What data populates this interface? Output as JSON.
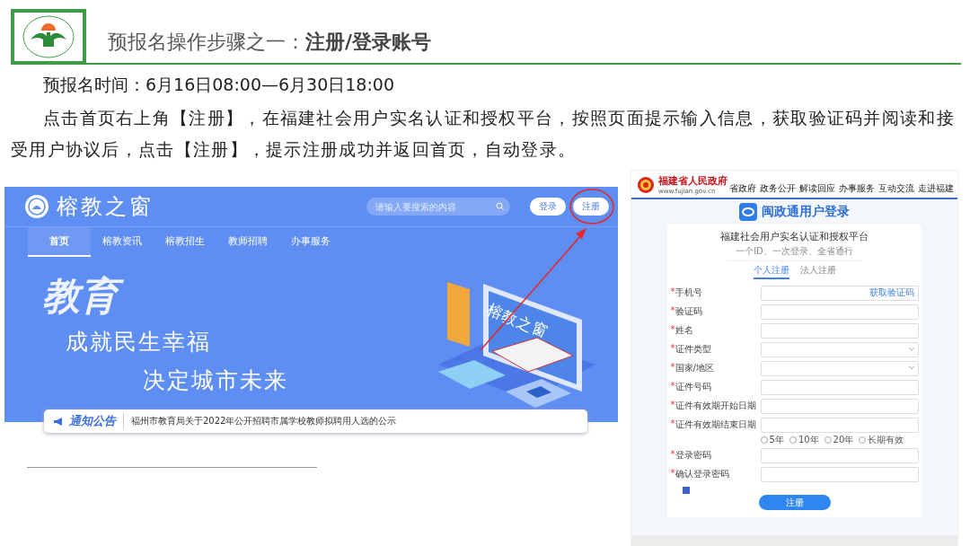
{
  "slide": {
    "title": "预报名操作步骤之一：**注册/登录账号**",
    "time_line": "预报名时间：6月16日08:00—6月30日18:00",
    "instructions": "点击首页右上角【注册】，在福建社会用户实名认证和授权平台，按照页面提示输入信息，获取验证码并阅读和接受用户协议后，点击【注册】，提示注册成功并返回首页，自动登录。"
  },
  "left_screenshot": {
    "site_name": "榕教之窗",
    "search": {
      "placeholder": "请输入要搜索的内容"
    },
    "buttons": [
      "登录",
      "注册"
    ],
    "nav": [
      {
        "label": "首页",
        "selected": true
      },
      {
        "label": "榕教资讯",
        "selected": false
      },
      {
        "label": "榕教招生",
        "selected": false
      },
      {
        "label": "教师招聘",
        "selected": false
      },
      {
        "label": "办事服务",
        "selected": false
      }
    ],
    "hero": {
      "headline": "教育",
      "line_1": "成就民生幸福",
      "line_2": "决定城市未来",
      "screen_label": "榕教之窗"
    },
    "notice": {
      "badge": "通知公告",
      "text": "福州市教育局关于2022年公开招聘市属学校教师拟聘用人选的公示"
    }
  },
  "right_screenshot": {
    "site_name": "福建省人民政府",
    "url": "www.fujian.gov.cn",
    "nav": [
      "省政府",
      "政务公开",
      "解读回应",
      "办事服务",
      "互动交流",
      "走进福建"
    ],
    "login_title": "闽政通用户登录",
    "card": {
      "title": "福建社会用户实名认证和授权平台",
      "subtitle": "一个ID、一次登录、全省通行",
      "tabs": [
        {
          "label": "个人注册",
          "selected": true
        },
        {
          "label": "法人注册",
          "selected": false
        }
      ],
      "fields": [
        {
          "label": "手机号",
          "required_mark": "*",
          "kind": "input",
          "action": "获取验证码"
        },
        {
          "label": "验证码",
          "required_mark": "*",
          "kind": "input"
        },
        {
          "label": "姓名",
          "required_mark": "*",
          "kind": "input"
        },
        {
          "label": "证件类型",
          "required_mark": "*",
          "kind": "select"
        },
        {
          "label": "国家/地区",
          "required_mark": "*",
          "kind": "select"
        },
        {
          "label": "证件号码",
          "required_mark": "*",
          "kind": "input"
        },
        {
          "label": "证件有效期开始日期",
          "required_mark": "*",
          "kind": "input"
        },
        {
          "label": "证件有效期结束日期",
          "required_mark": "*",
          "kind": "input"
        }
      ],
      "validity_options": [
        {
          "label": "5年",
          "selected": false
        },
        {
          "label": "10年",
          "selected": false
        },
        {
          "label": "20年",
          "selected": false
        },
        {
          "label": "长期有效",
          "selected": false
        }
      ],
      "password_fields": [
        {
          "label": "登录密码",
          "required_mark": "*",
          "kind": "input"
        },
        {
          "label": "确认登录密码",
          "required_mark": "*",
          "kind": "input"
        }
      ],
      "agreement_checked": true,
      "submit": "注册"
    }
  }
}
